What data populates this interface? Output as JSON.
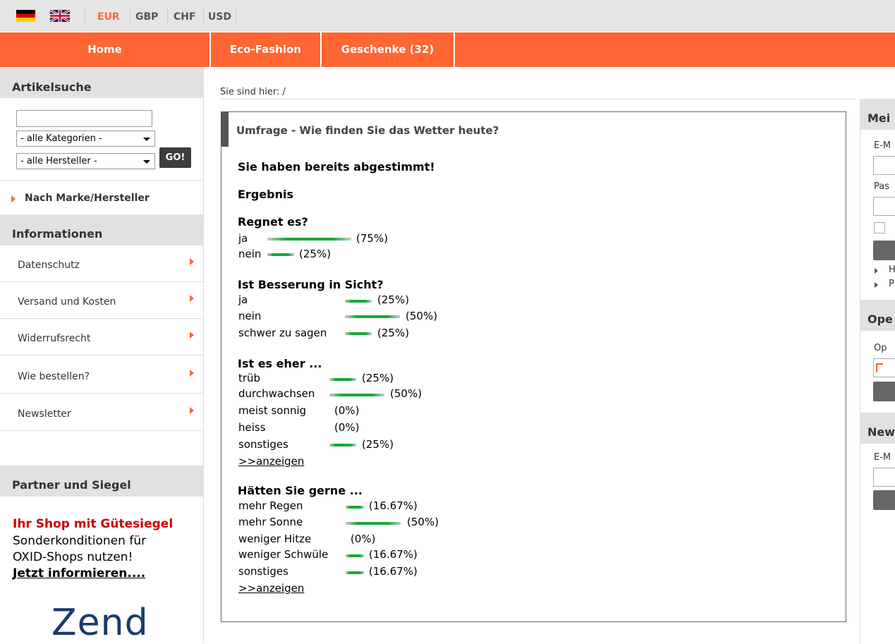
{
  "topbar": {
    "currencies": [
      {
        "label": "EUR",
        "active": true
      },
      {
        "label": "GBP"
      },
      {
        "label": "CHF"
      },
      {
        "label": "USD"
      }
    ]
  },
  "nav": {
    "items": [
      "Home",
      "Eco-Fashion",
      "Geschenke (32)"
    ]
  },
  "left": {
    "search_heading": "Artikelsuche",
    "category_select": "- alle Kategorien -",
    "manufacturer_select": "- alle Hersteller -",
    "go_label": "GO!",
    "brand_link": "Nach Marke/Hersteller",
    "info_heading": "Informationen",
    "info_links": [
      "Datenschutz",
      "Versand und Kosten",
      "Widerrufsrecht",
      "Wie bestellen?",
      "Newsletter"
    ],
    "partner_heading": "Partner und Siegel",
    "promo": {
      "title": "Ihr Shop mit Gütesiegel",
      "line1": "Sonderkonditionen für",
      "line2": "OXID-Shops nutzen!",
      "cta": "Jetzt informieren....",
      "logo": "Zend"
    }
  },
  "breadcrumb": "Sie sind hier: /",
  "poll": {
    "title": "Umfrage - Wie finden Sie das Wetter heute?",
    "voted": "Sie haben bereits abgestimmt!",
    "result": "Ergebnis",
    "show_more": ">>anzeigen",
    "questions": [
      {
        "q": "Regnet es?",
        "answers": [
          {
            "label": "ja",
            "pct": "(75%)",
            "value": 75
          },
          {
            "label": "nein",
            "pct": "(25%)",
            "value": 25
          }
        ]
      },
      {
        "q": "Ist Besserung in Sicht?",
        "answers": [
          {
            "label": "ja",
            "pct": "(25%)",
            "value": 25
          },
          {
            "label": "nein",
            "pct": "(50%)",
            "value": 50
          },
          {
            "label": "schwer zu sagen",
            "pct": "(25%)",
            "value": 25
          }
        ]
      },
      {
        "q": "Ist es eher ...",
        "answers": [
          {
            "label": "trüb",
            "pct": "(25%)",
            "value": 25
          },
          {
            "label": "durchwachsen",
            "pct": "(50%)",
            "value": 50
          },
          {
            "label": "meist sonnig",
            "pct": "(0%)",
            "value": 0
          },
          {
            "label": "heiss",
            "pct": "(0%)",
            "value": 0
          },
          {
            "label": "sonstiges",
            "pct": "(25%)",
            "value": 25
          }
        ]
      },
      {
        "q": "Hätten Sie gerne ...",
        "answers": [
          {
            "label": "mehr Regen",
            "pct": "(16.67%)",
            "value": 16.67
          },
          {
            "label": "mehr Sonne",
            "pct": "(50%)",
            "value": 50
          },
          {
            "label": "weniger Hitze",
            "pct": "(0%)",
            "value": 0
          },
          {
            "label": "weniger Schwüle",
            "pct": "(16.67%)",
            "value": 16.67
          },
          {
            "label": "sonstiges",
            "pct": "(16.67%)",
            "value": 16.67
          }
        ]
      }
    ]
  },
  "right": {
    "h1": "Mei",
    "t1": "E-M",
    "t2": "Pas",
    "l1": "H",
    "l2": "P",
    "h2": "Ope",
    "t3": "Op",
    "h3": "New",
    "t4": "E-M"
  }
}
